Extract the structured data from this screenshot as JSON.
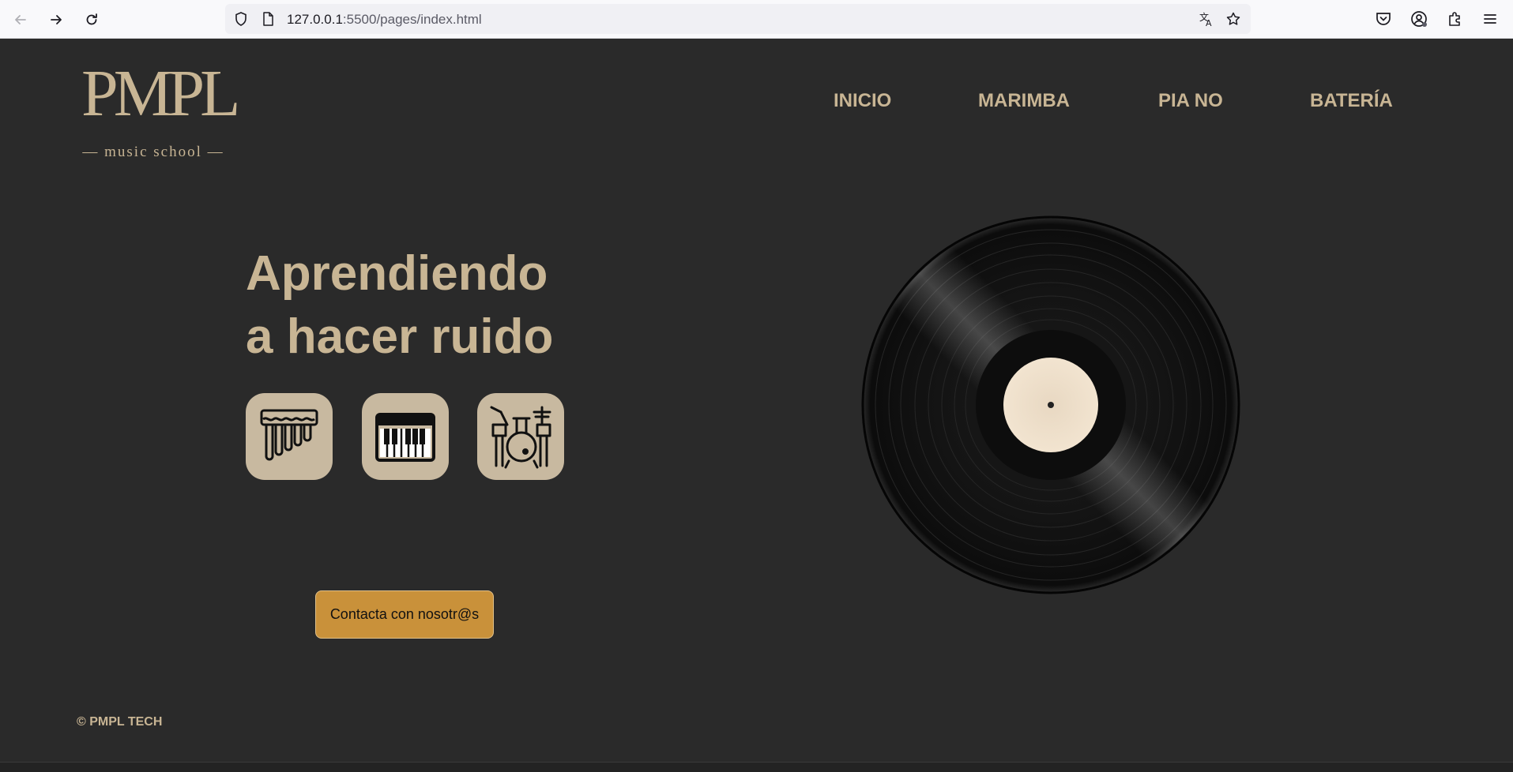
{
  "browser": {
    "url_host": "127.0.0.1",
    "url_path": ":5500/pages/index.html"
  },
  "logo": {
    "main": "PMPL",
    "sub": "— music school —"
  },
  "nav": {
    "items": [
      {
        "label": "INICIO"
      },
      {
        "label": "MARIMBA"
      },
      {
        "label": "PIA NO"
      },
      {
        "label": "BATERÍA"
      }
    ]
  },
  "hero": {
    "title_line1": "Aprendiendo",
    "title_line2": "a hacer ruido"
  },
  "instruments": [
    {
      "icon": "pan-flute-icon"
    },
    {
      "icon": "piano-keyboard-icon"
    },
    {
      "icon": "drum-kit-icon"
    }
  ],
  "contact": {
    "label": "Contacta con nosotr@s"
  },
  "footer": {
    "copyright": "© PMPL TECH"
  },
  "colors": {
    "background": "#2a2a2a",
    "accent": "#c8b594",
    "button": "#c9913a",
    "tile": "#c8b9a0"
  }
}
